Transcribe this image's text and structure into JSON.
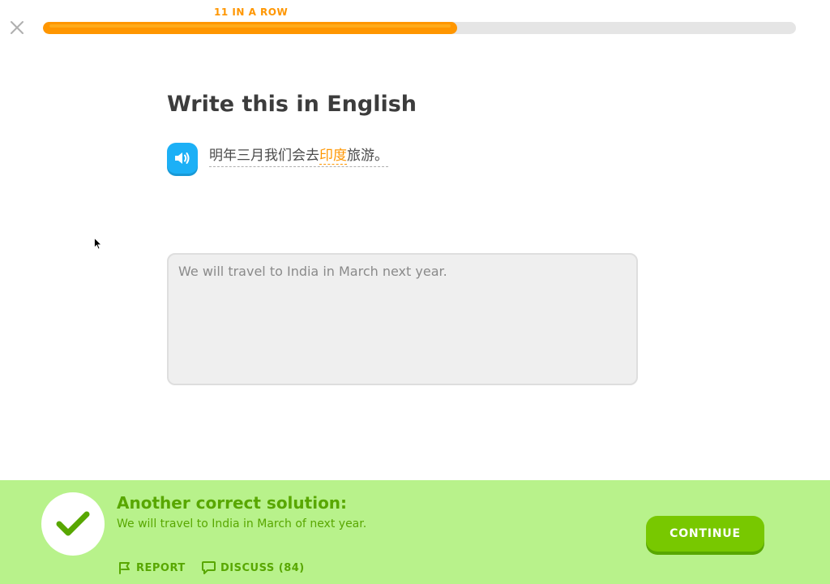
{
  "header": {
    "streak_label": "11 IN A ROW",
    "progress_fraction": 0.55
  },
  "challenge": {
    "title": "Write this in English",
    "prompt_parts": {
      "before": "明年三月我们会去",
      "highlighted": "印度",
      "after": "旅游。"
    },
    "answer_text": "We will travel to India in March next year."
  },
  "feedback": {
    "heading": "Another correct solution:",
    "solution": "We will travel to India in March of next year.",
    "report_label": "REPORT",
    "discuss_label": "DISCUSS (84)",
    "continue_label": "CONTINUE"
  },
  "icons": {
    "close": "close-icon",
    "speaker": "speaker-icon",
    "check": "checkmark-icon",
    "report": "flag-icon",
    "discuss": "speech-bubble-icon"
  },
  "colors": {
    "accent_orange": "#ff9600",
    "speaker_blue": "#1cb0f6",
    "success_bg": "#b8f28b",
    "success_text": "#58a700",
    "continue_green": "#78c800"
  }
}
